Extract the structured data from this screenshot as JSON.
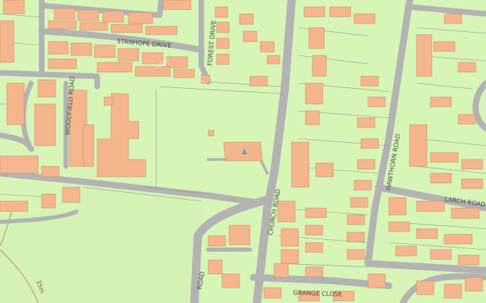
{
  "map": {
    "colors": {
      "land": "#d6f5b6",
      "road": "#b3b3b3",
      "building": "#f5b58d",
      "building_edge": "#c98a66",
      "plot_line": "#8a8a8a",
      "contour": "#b78a6a",
      "marker": "#5aa9e6"
    },
    "labels": {
      "stanhope_drive": "STANHOPE DRIVE",
      "forest_drive": "FOREST DRIVE",
      "woodfield_road": "WOODFIELD ROAD",
      "church_road": "CHURCH ROAD",
      "hawthorn_road": "HAWTHORN ROAD",
      "larch_road": "LARCH ROAD",
      "grange_close": "GRANGE CLOSE",
      "partial_road": "ROAD",
      "contour_35m": "35m",
      "partial_hope": "hope"
    }
  }
}
